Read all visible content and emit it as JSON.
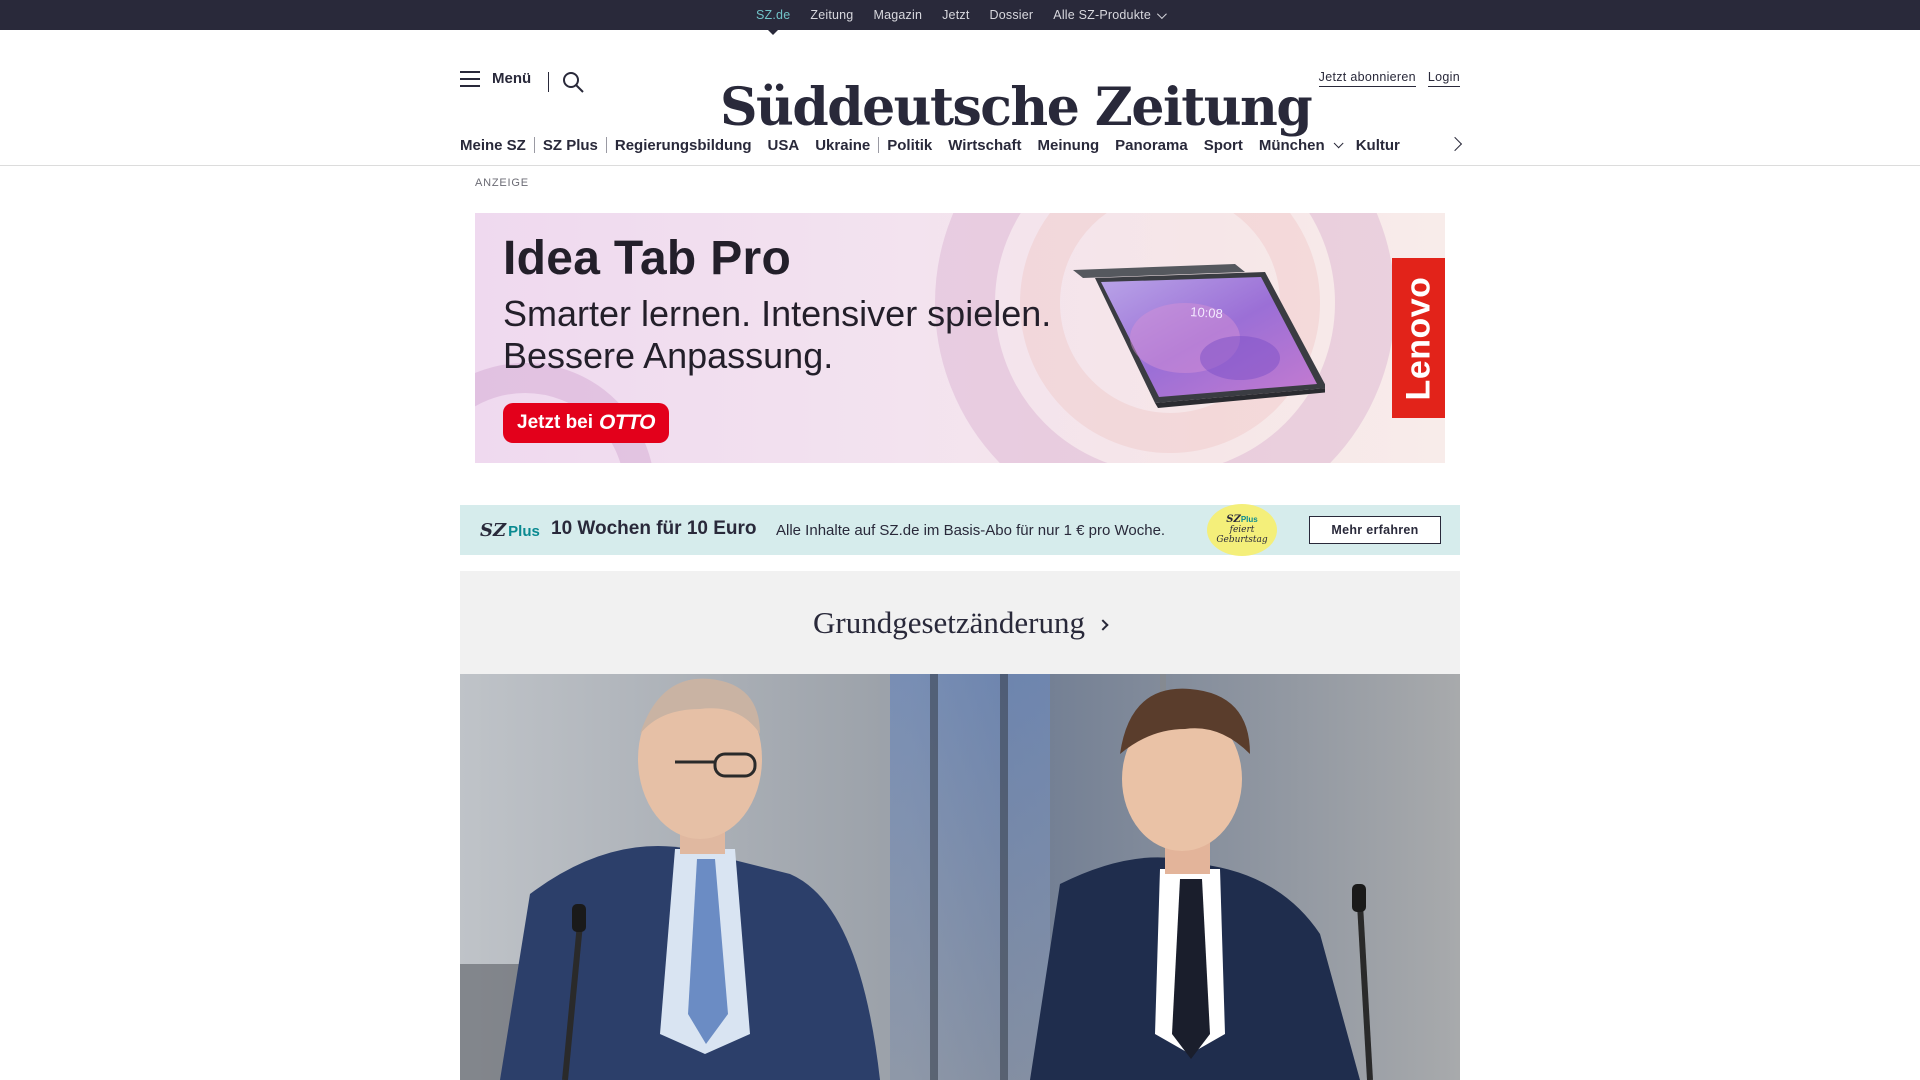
{
  "topbar": {
    "items": [
      {
        "label": "SZ.de",
        "active": true
      },
      {
        "label": "Zeitung"
      },
      {
        "label": "Magazin"
      },
      {
        "label": "Jetzt"
      },
      {
        "label": "Dossier"
      },
      {
        "label": "Alle SZ-Produkte"
      }
    ],
    "active_color": "#71c3c8",
    "background": "#29293a"
  },
  "header": {
    "menu_label": "Menü",
    "logo_text": "Süddeutsche Zeitung",
    "subscribe_label": "Jetzt abonnieren",
    "login_label": "Login"
  },
  "ressorts": [
    "Meine SZ",
    "SZ Plus",
    "Regierungsbildung",
    "USA",
    "Ukraine",
    "Politik",
    "Wirtschaft",
    "Meinung",
    "Panorama",
    "Sport",
    "München",
    "Kultur"
  ],
  "ad": {
    "label": "ANZEIGE",
    "title": "Idea Tab Pro",
    "subtitle": "Smarter lernen. Intensiver spielen. Bessere Anpassung.",
    "cta_prefix": "Jetzt bei",
    "cta_brand": "OTTO",
    "brand": "Lenovo",
    "tablet_time": "10:08",
    "brand_color": "#e2231a"
  },
  "szplus": {
    "logo": "SZ",
    "logo_plus": "Plus",
    "headline": "10 Wochen für 10 Euro",
    "text": "Alle Inhalte auf SZ.de im Basis-Abo für nur 1 € pro Woche.",
    "badge_line1": "SZ",
    "badge_plus": "Plus",
    "badge_line2": "feiert",
    "badge_line3": "Geburtstag",
    "button_label": "Mehr erfahren",
    "background": "#d6ecec"
  },
  "topic": {
    "label": "Grundgesetzänderung"
  }
}
